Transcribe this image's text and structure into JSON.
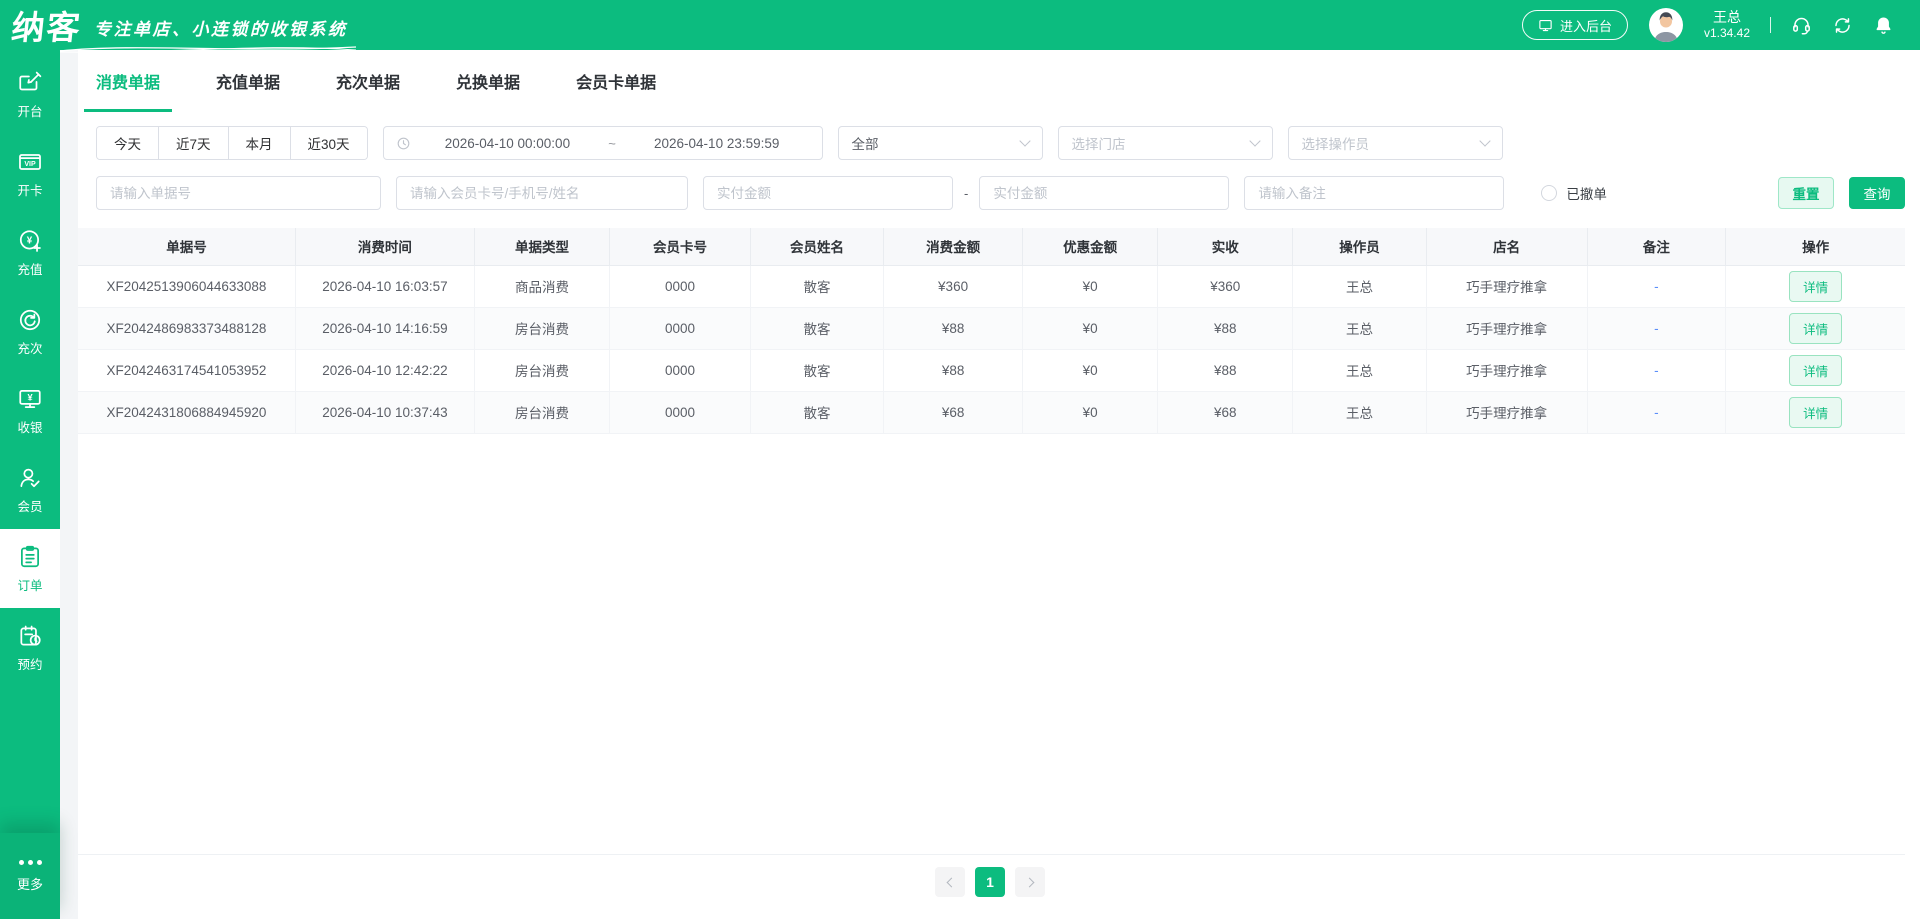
{
  "topbar": {
    "logo": "纳客",
    "tagline": "专注单店、小连锁的收银系统",
    "backstage_button": "进入后台",
    "user_name": "王总",
    "version": "v1.34.42",
    "icons": [
      "monitor-icon",
      "headset-icon",
      "sync-icon",
      "bell-icon"
    ]
  },
  "sidebar": {
    "items": [
      {
        "label": "开台",
        "icon": "open-table-icon",
        "active": false
      },
      {
        "label": "开卡",
        "icon": "vip-card-icon",
        "active": false
      },
      {
        "label": "充值",
        "icon": "recharge-icon",
        "active": false
      },
      {
        "label": "充次",
        "icon": "recharge-count-icon",
        "active": false
      },
      {
        "label": "收银",
        "icon": "cashier-icon",
        "active": false
      },
      {
        "label": "会员",
        "icon": "member-icon",
        "active": false
      },
      {
        "label": "订单",
        "icon": "orders-icon",
        "active": true
      },
      {
        "label": "预约",
        "icon": "appointment-icon",
        "active": false
      }
    ],
    "more_label": "更多",
    "more_icon": "more-dots-icon"
  },
  "tabs": [
    {
      "label": "消费单据",
      "active": true
    },
    {
      "label": "充值单据",
      "active": false
    },
    {
      "label": "充次单据",
      "active": false
    },
    {
      "label": "兑换单据",
      "active": false
    },
    {
      "label": "会员卡单据",
      "active": false
    }
  ],
  "filters": {
    "quick_ranges": [
      "今天",
      "近7天",
      "本月",
      "近30天"
    ],
    "date_start": "2026-04-10 00:00:00",
    "date_separator": "~",
    "date_end": "2026-04-10 23:59:59",
    "type_select_value": "全部",
    "store_select_placeholder": "选择门店",
    "operator_select_placeholder": "选择操作员",
    "order_no_placeholder": "请输入单据号",
    "member_placeholder": "请输入会员卡号/手机号/姓名",
    "amount_min_placeholder": "实付金额",
    "amount_range_separator": "-",
    "amount_max_placeholder": "实付金额",
    "remark_placeholder": "请输入备注",
    "revoked_label": "已撤单",
    "reset_button": "重置",
    "search_button": "查询"
  },
  "table": {
    "columns": [
      "单据号",
      "消费时间",
      "单据类型",
      "会员卡号",
      "会员姓名",
      "消费金额",
      "优惠金额",
      "实收",
      "操作员",
      "店名",
      "备注",
      "操作"
    ],
    "action_label": "详情",
    "rows": [
      {
        "order_no": "XF2042513906044633088",
        "time": "2026-04-10 16:03:57",
        "type": "商品消费",
        "card_no": "0000",
        "member": "散客",
        "amount": "¥360",
        "discount": "¥0",
        "paid": "¥360",
        "operator": "王总",
        "store": "巧手理疗推拿",
        "remark": "-"
      },
      {
        "order_no": "XF2042486983373488128",
        "time": "2026-04-10 14:16:59",
        "type": "房台消费",
        "card_no": "0000",
        "member": "散客",
        "amount": "¥88",
        "discount": "¥0",
        "paid": "¥88",
        "operator": "王总",
        "store": "巧手理疗推拿",
        "remark": "-"
      },
      {
        "order_no": "XF2042463174541053952",
        "time": "2026-04-10 12:42:22",
        "type": "房台消费",
        "card_no": "0000",
        "member": "散客",
        "amount": "¥88",
        "discount": "¥0",
        "paid": "¥88",
        "operator": "王总",
        "store": "巧手理疗推拿",
        "remark": "-"
      },
      {
        "order_no": "XF2042431806884945920",
        "time": "2026-04-10 10:37:43",
        "type": "房台消费",
        "card_no": "0000",
        "member": "散客",
        "amount": "¥68",
        "discount": "¥0",
        "paid": "¥68",
        "operator": "王总",
        "store": "巧手理疗推拿",
        "remark": "-"
      }
    ]
  },
  "pagination": {
    "current_page": "1",
    "prev_icon": "chevron-left-icon",
    "next_icon": "chevron-right-icon"
  },
  "colors": {
    "brand_green": "#0CBC7F",
    "brand_green_dark": "#0BB378",
    "light_green_bg": "#E7F9F1",
    "table_header_bg": "#F7F8FA",
    "remark_blue": "#5B8FF9"
  }
}
